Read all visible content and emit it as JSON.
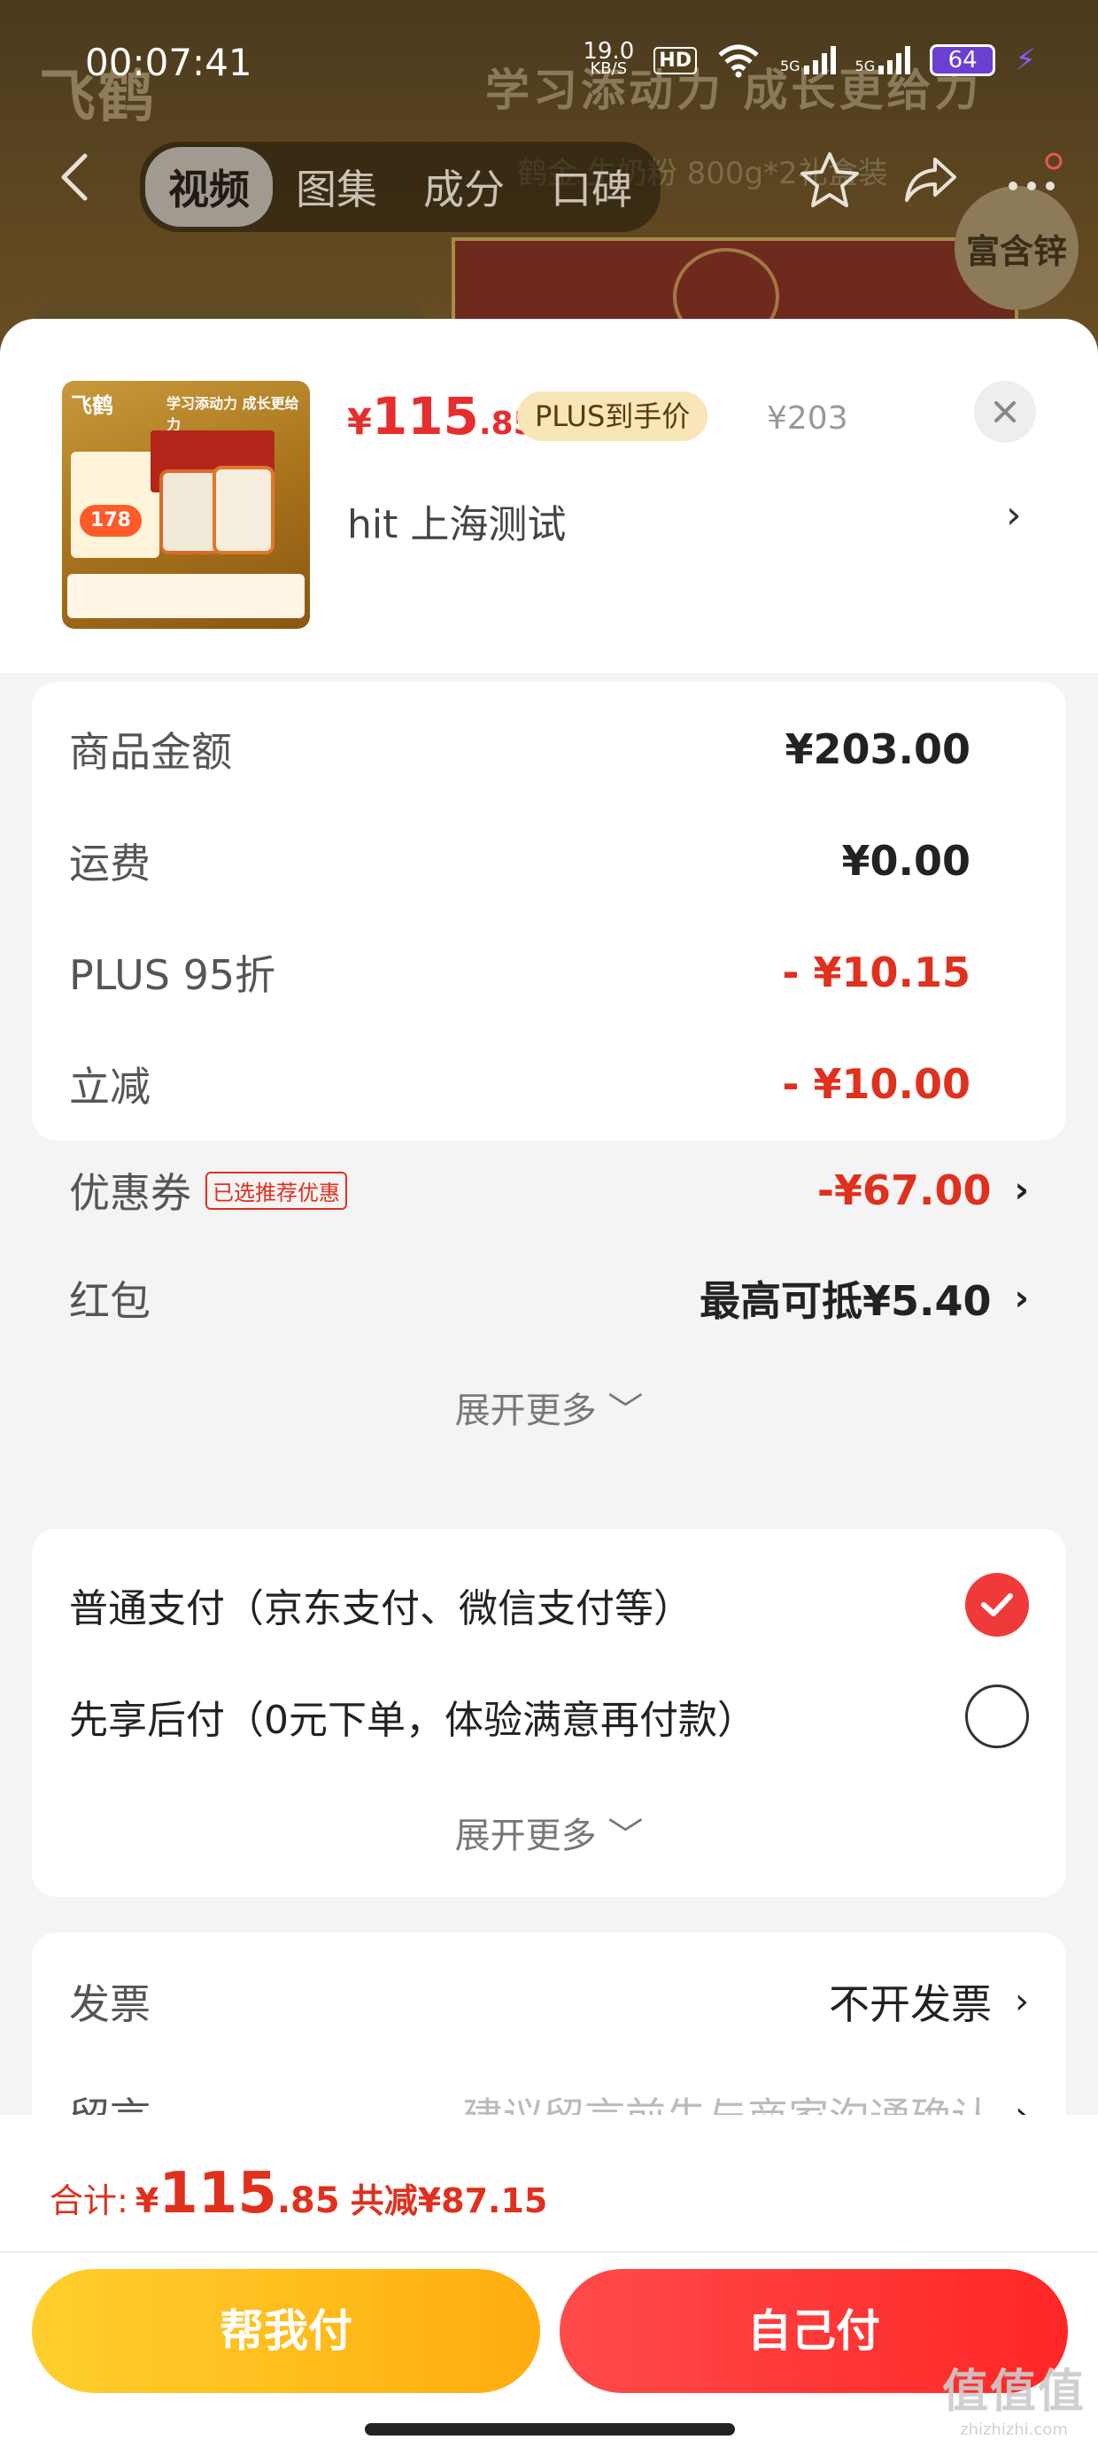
{
  "status_bar": {
    "time": "00:07:41",
    "net_speed_value": "19.0",
    "net_speed_unit": "KB/S",
    "hd_label": "HD",
    "signal1_label": "5G",
    "signal2_label": "5G",
    "battery": "64"
  },
  "background": {
    "brand": "飞鹤",
    "slogan": "学习添动力 成长更给力",
    "subtitle": "鹤金  生奶粉 800g*2礼盒装",
    "feature_badge": "富含锌",
    "tabs": [
      "视频",
      "图集",
      "成分",
      "口碑"
    ],
    "active_tab": 0
  },
  "product": {
    "thumb_brand": "飞鹤",
    "thumb_slogan": "学习添动力 成长更给力",
    "thumb_price": "178",
    "price_currency": "¥",
    "price_integer": "115",
    "price_decimal": ".85",
    "plus_badge": "PLUS到手价",
    "original_price": "¥203",
    "address": "hit  上海测试"
  },
  "price_details": {
    "rows": [
      {
        "label": "商品金额",
        "value": "¥203.00"
      },
      {
        "label": "运费",
        "value": "¥0.00"
      },
      {
        "label": "PLUS 95折",
        "value": "- ¥10.15"
      },
      {
        "label": "立减",
        "value": "- ¥10.00"
      },
      {
        "label": "优惠券",
        "tag": "已选推荐优惠",
        "value": "-¥67.00"
      },
      {
        "label": "红包",
        "value": "最高可抵¥5.40"
      }
    ],
    "expand_label": "展开更多"
  },
  "payment": {
    "options": [
      {
        "label": "普通支付（京东支付、微信支付等）",
        "checked": true
      },
      {
        "label": "先享后付（0元下单，体验满意再付款）",
        "checked": false
      }
    ],
    "expand_label": "展开更多"
  },
  "invoice": {
    "label": "发票",
    "value": "不开发票",
    "note_label": "留言",
    "note_placeholder": "建议留言前先与商家沟通确认"
  },
  "bottom": {
    "total_label": "合计:",
    "total_currency": "¥",
    "total_integer": "115",
    "total_decimal": ".85",
    "saved": "共减¥87.15",
    "help_pay": "帮我付",
    "self_pay": "自己付"
  },
  "watermark": {
    "big": "值值值",
    "small": "zhizhizhi.com"
  },
  "colors": {
    "accent_red": "#e0301e",
    "help_yellow": "#ffbd1e",
    "pay_red": "#ff3535"
  }
}
